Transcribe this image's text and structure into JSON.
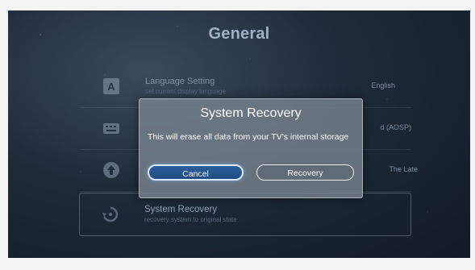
{
  "screen": {
    "title": "General",
    "settings": [
      {
        "icon": "language-icon",
        "label": "Language Setting",
        "sub": "set current display language",
        "value": "English"
      },
      {
        "icon": "keyboard-icon",
        "label": "",
        "sub": "",
        "value": "d (AOSP)"
      },
      {
        "icon": "update-icon",
        "label": "",
        "sub": "",
        "value": "The Late"
      },
      {
        "icon": "recovery-icon",
        "label": "System Recovery",
        "sub": "recovery system to original state",
        "value": ""
      }
    ]
  },
  "dialog": {
    "title": "System Recovery",
    "message": "This will erase all data from your TV's internal storage",
    "cancel_label": "Cancel",
    "confirm_label": "Recovery"
  },
  "colors": {
    "background": "#1d2a38",
    "dialog": "#787f88",
    "focus_button": "#2b5f9c"
  }
}
